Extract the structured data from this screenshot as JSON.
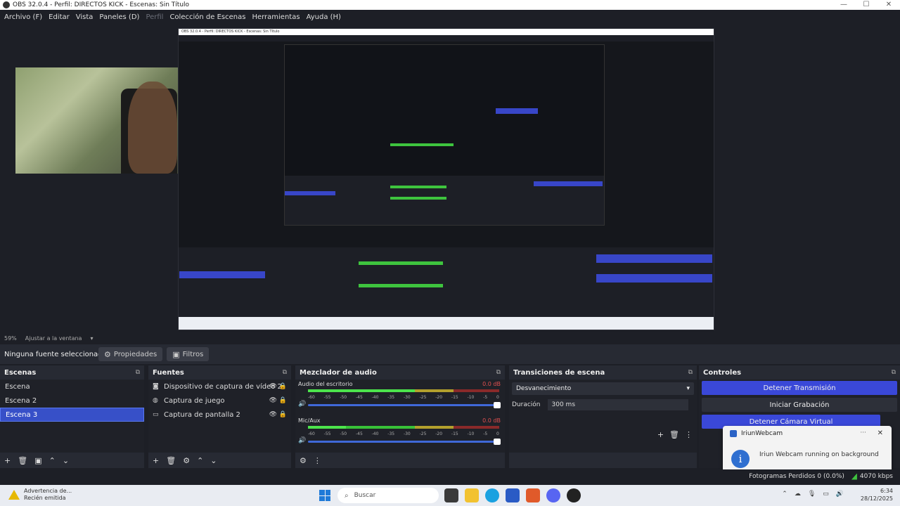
{
  "window": {
    "title": "OBS 32.0.4 - Perfil: DIRECTOS KICK - Escenas: Sin Título",
    "controls": [
      "—",
      "☐",
      "✕"
    ]
  },
  "menu": [
    "Archivo (F)",
    "Editar",
    "Vista",
    "Paneles (D)",
    "Perfil",
    "Colección de Escenas",
    "Herramientas",
    "Ayuda (H)"
  ],
  "preview_status": {
    "zoom": "59%",
    "fit": "Ajustar a la ventana"
  },
  "toolbar": {
    "no_source": "Ninguna fuente seleccionada",
    "properties": "Propiedades",
    "filters": "Filtros"
  },
  "scenes": {
    "title": "Escenas",
    "items": [
      "Escena",
      "Escena 2",
      "Escena 3"
    ],
    "selected_index": 2
  },
  "sources": {
    "title": "Fuentes",
    "items": [
      {
        "name": "Dispositivo de captura de vídeo 2",
        "icon": "camera-icon"
      },
      {
        "name": "Captura de juego",
        "icon": "gamepad-icon"
      },
      {
        "name": "Captura de pantalla 2",
        "icon": "monitor-icon"
      }
    ]
  },
  "mixer": {
    "title": "Mezclador de audio",
    "channels": [
      {
        "name": "Audio del escritorio",
        "db": "0.0 dB",
        "level": 0.56,
        "volume": 1.0
      },
      {
        "name": "Mic/Aux",
        "db": "0.0 dB",
        "level": 0.2,
        "volume": 1.0
      }
    ],
    "ticks": [
      "-60",
      "-55",
      "-50",
      "-45",
      "-40",
      "-35",
      "-30",
      "-25",
      "-20",
      "-15",
      "-10",
      "-5",
      "0"
    ]
  },
  "transitions": {
    "title": "Transiciones de escena",
    "selected": "Desvanecimiento",
    "duration_label": "Duración",
    "duration_value": "300 ms"
  },
  "controls": {
    "title": "Controles",
    "buttons": [
      {
        "label": "Detener Transmisión",
        "active": true
      },
      {
        "label": "Iniciar Grabación",
        "active": false
      },
      {
        "label": "Detener Cámara Virtual",
        "active": true
      }
    ]
  },
  "notification": {
    "app": "IriunWebcam",
    "message": "Iriun Webcam running on background",
    "more": "···",
    "close": "✕"
  },
  "statusbar": {
    "frames": "Fotogramas Perdidos 0 (0.0%)",
    "kbps": "4070 kbps"
  },
  "taskbar": {
    "warning_title": "Advertencia de...",
    "warning_sub": "Recién emitida",
    "search": "Buscar",
    "time": "6:34",
    "date": "28/12/2025"
  },
  "colors": {
    "accent": "#3a48d8",
    "selected": "#3750c8",
    "meter_green": "#38c238",
    "meter_yellow": "#b3a02d",
    "meter_red": "#8a2a2a"
  }
}
